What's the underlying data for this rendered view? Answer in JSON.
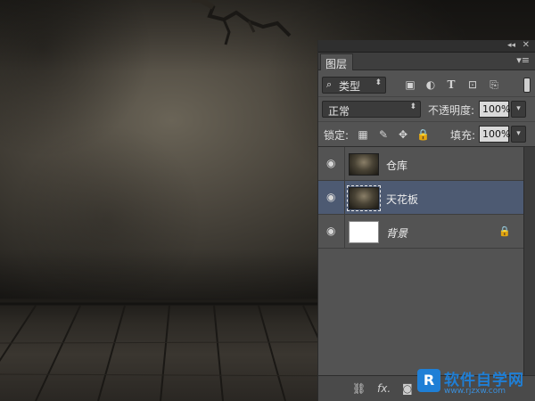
{
  "panel": {
    "collapse_icon": "double-chevron-left-icon",
    "close_icon": "close-x-icon",
    "tab_title": "图层",
    "menu_icon": "panel-menu-icon",
    "filter": {
      "search_icon": "magnifier-icon",
      "label": "类型",
      "icons": [
        "pixel-filter-icon",
        "adjustment-filter-icon",
        "type-filter-icon",
        "shape-filter-icon",
        "smart-object-filter-icon"
      ]
    },
    "blend": {
      "mode": "正常",
      "opacity_label": "不透明度:",
      "opacity_value": "100%"
    },
    "lock": {
      "label": "锁定:",
      "icons": [
        "lock-transparent-icon",
        "lock-paint-icon",
        "lock-move-icon",
        "lock-all-icon"
      ],
      "fill_label": "填充:",
      "fill_value": "100%"
    },
    "layers": [
      {
        "name": "仓库",
        "visible": true,
        "selected": false,
        "locked": false,
        "thumbnail": "dark-room"
      },
      {
        "name": "天花板",
        "visible": true,
        "selected": true,
        "locked": false,
        "thumbnail": "dark-room"
      },
      {
        "name": "背景",
        "visible": true,
        "selected": false,
        "locked": true,
        "thumbnail": "white"
      }
    ],
    "bottom_icons": [
      "link-layers-icon",
      "fx-icon",
      "add-mask-icon"
    ],
    "colors": {
      "panel_bg": "#535353",
      "selected_row": "#4d5a72"
    }
  },
  "watermark": {
    "logo_text": "R",
    "title": "软件自学网",
    "url": "www.rjzxw.com",
    "color": "#1f7fd6"
  }
}
